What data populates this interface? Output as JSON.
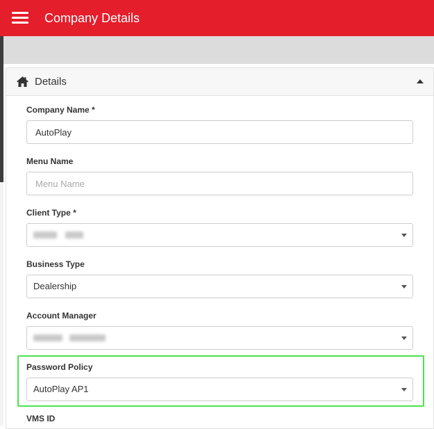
{
  "header": {
    "title": "Company Details",
    "menu_icon": "hamburger-menu-icon",
    "background_color": "#e41e2b"
  },
  "panel": {
    "title": "Details",
    "icon": "home-icon",
    "collapse_icon": "caret-up-icon"
  },
  "fields": {
    "company_name": {
      "label": "Company Name *",
      "value": "AutoPlay"
    },
    "menu_name": {
      "label": "Menu Name",
      "value": "",
      "placeholder": "Menu Name"
    },
    "client_type": {
      "label": "Client Type *",
      "value_redacted": true
    },
    "business_type": {
      "label": "Business Type",
      "value": "Dealership"
    },
    "account_manager": {
      "label": "Account Manager",
      "value_redacted": true
    },
    "password_policy": {
      "label": "Password Policy",
      "value": "AutoPlay AP1",
      "highlight_color": "#4ce34c"
    },
    "vms_id": {
      "label": "VMS ID"
    }
  }
}
